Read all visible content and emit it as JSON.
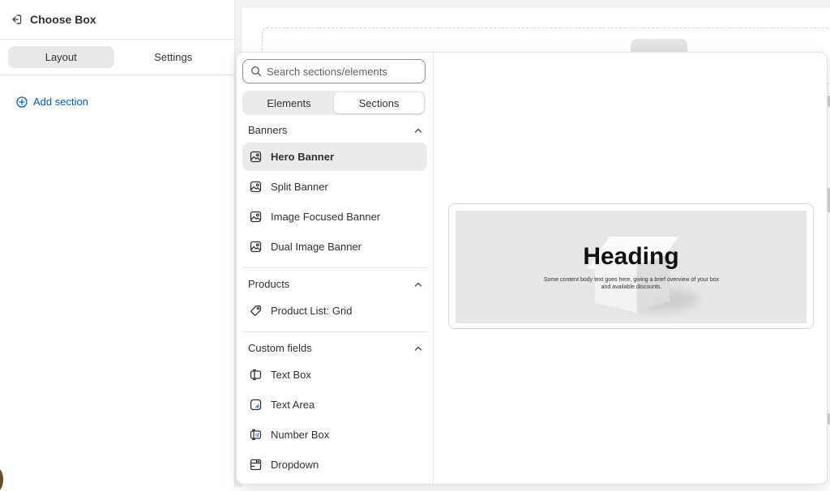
{
  "sidebar": {
    "title": "Choose Box",
    "tabs": [
      {
        "label": "Layout",
        "active": true
      },
      {
        "label": "Settings",
        "active": false
      }
    ],
    "add_section": "Add section"
  },
  "picker": {
    "search_placeholder": "Search sections/elements",
    "segments": [
      {
        "label": "Elements",
        "active": false
      },
      {
        "label": "Sections",
        "active": true
      }
    ],
    "groups": [
      {
        "title": "Banners",
        "items": [
          {
            "label": "Hero Banner",
            "icon": "image-icon",
            "active": true
          },
          {
            "label": "Split Banner",
            "icon": "image-icon"
          },
          {
            "label": "Image Focused Banner",
            "icon": "image-icon"
          },
          {
            "label": "Dual Image Banner",
            "icon": "image-icon"
          }
        ]
      },
      {
        "title": "Products",
        "items": [
          {
            "label": "Product List: Grid",
            "icon": "tag-icon"
          }
        ]
      },
      {
        "title": "Custom fields",
        "items": [
          {
            "label": "Text Box",
            "icon": "text-box-icon"
          },
          {
            "label": "Text Area",
            "icon": "text-area-icon"
          },
          {
            "label": "Number Box",
            "icon": "number-box-icon"
          },
          {
            "label": "Dropdown",
            "icon": "dropdown-icon"
          }
        ]
      }
    ]
  },
  "preview": {
    "heading": "Heading",
    "body": "Some content body text goes here, giving a brief overview of your box and available discounts."
  },
  "colors": {
    "link": "#005bd3",
    "text": "#303030",
    "active_bg": "#ebebeb",
    "border": "#e3e3e3"
  }
}
